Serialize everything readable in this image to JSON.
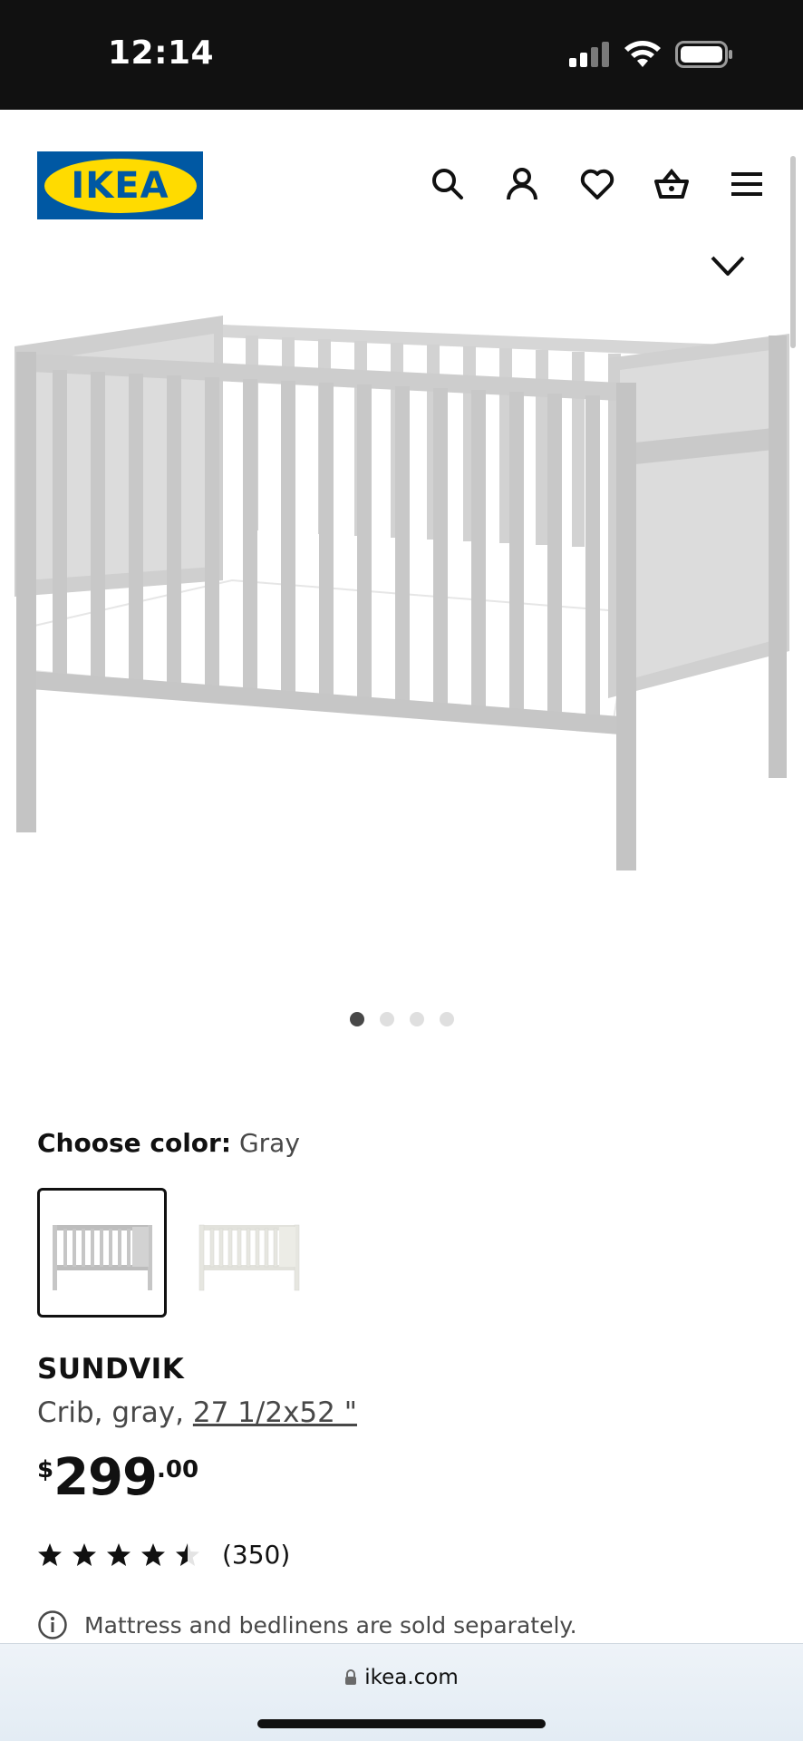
{
  "status_bar": {
    "time": "12:14"
  },
  "header": {
    "logo_text": "IKEA",
    "icons": [
      "search-icon",
      "account-icon",
      "heart-icon",
      "shopping-basket-icon",
      "menu-icon"
    ]
  },
  "gallery": {
    "image_count": 4,
    "active_index": 0
  },
  "color": {
    "label": "Choose color:",
    "value": "Gray"
  },
  "product": {
    "name": "SUNDVIK",
    "description_prefix": "Crib, gray, ",
    "size": "27 1/2x52 \"",
    "price": {
      "currency": "$",
      "integer": "299",
      "decimal": ".00"
    },
    "rating": {
      "stars": 4.5,
      "max": 5,
      "count": "(350)"
    },
    "note": "Mattress and bedlinens are sold separately."
  },
  "browser": {
    "url": "ikea.com"
  },
  "colors": {
    "brand_blue": "#0058a3",
    "brand_yellow": "#ffdb00",
    "text": "#111111",
    "secondary_text": "#484848"
  }
}
